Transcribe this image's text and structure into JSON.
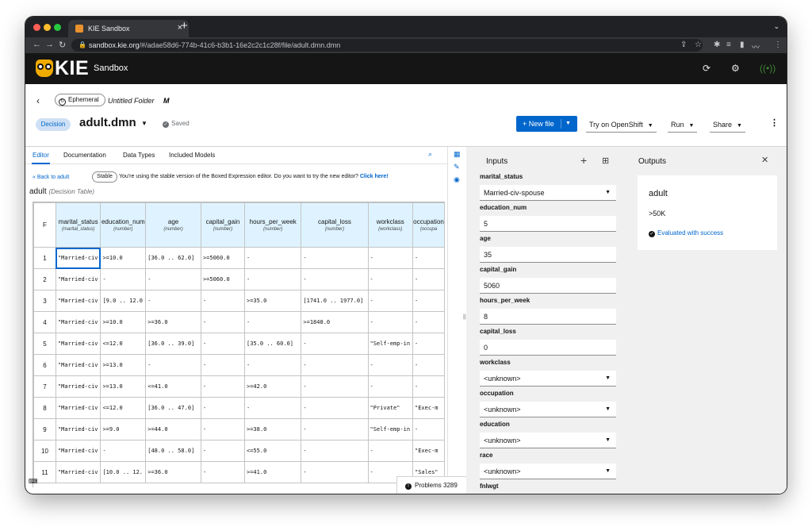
{
  "browser": {
    "tab_title": "KIE Sandbox",
    "tab_close": "×",
    "new_tab": "+",
    "url_host": "sandbox.kie.org",
    "url_path": "/#/adae58d6-774b-41c6-b3b1-16e2c2c1c28f/file/adult.dmn.dmn"
  },
  "app": {
    "logo_text": "KIE",
    "name": "Sandbox"
  },
  "header": {
    "ephemeral_label": "Ephemeral",
    "folder_name": "Untitled Folder",
    "folder_badge": "M",
    "type_badge": "Decision",
    "file_name": "adult.dmn",
    "saved_label": "Saved",
    "new_file_label": "New file",
    "openshift_label": "Try on OpenShift",
    "run_label": "Run",
    "share_label": "Share"
  },
  "editor": {
    "tabs": [
      "Editor",
      "Documentation",
      "Data Types",
      "Included Models"
    ],
    "back_link": "Back to adult",
    "stable_badge": "Stable",
    "notice_text": "You're using the stable version of the Boxed Expression editor. Do you want to try the new editor?",
    "notice_link": "Click here!",
    "table_name": "adult",
    "table_kind": "(Decision Table)",
    "hit_policy": "F",
    "columns": [
      {
        "name": "marital_status",
        "type": "(marital_status)"
      },
      {
        "name": "education_num",
        "type": "(number)"
      },
      {
        "name": "age",
        "type": "(number)"
      },
      {
        "name": "capital_gain",
        "type": "(number)"
      },
      {
        "name": "hours_per_week",
        "type": "(number)"
      },
      {
        "name": "capital_loss",
        "type": "(number)"
      },
      {
        "name": "workclass",
        "type": "(workclass)"
      },
      {
        "name": "occupation",
        "type": "(occupa"
      }
    ],
    "rows": [
      [
        "1",
        "\"Married-civ",
        ">=10.0",
        "[36.0 .. 62.0]",
        ">=5060.0",
        "-",
        "-",
        "-",
        "-"
      ],
      [
        "2",
        "\"Married-civ",
        "-",
        "-",
        ">=5060.0",
        "-",
        "-",
        "-",
        "-"
      ],
      [
        "3",
        "\"Married-civ",
        "[9.0 .. 12.0",
        "-",
        "-",
        ">=35.0",
        "[1741.0 .. 1977.0]",
        "-",
        "-"
      ],
      [
        "4",
        "\"Married-civ",
        ">=10.0",
        ">=36.0",
        "-",
        "-",
        ">=1848.0",
        "-",
        "-"
      ],
      [
        "5",
        "\"Married-civ",
        "<=12.0",
        "[36.0 .. 39.0]",
        "-",
        "[35.0 .. 60.0]",
        "-",
        "\"Self-emp-in",
        "-"
      ],
      [
        "6",
        "\"Married-civ",
        ">=13.0",
        "-",
        "-",
        "-",
        "-",
        "-",
        "-"
      ],
      [
        "7",
        "\"Married-civ",
        ">=13.0",
        "<=41.0",
        "-",
        ">=42.0",
        "-",
        "-",
        "-"
      ],
      [
        "8",
        "\"Married-civ",
        "<=12.0",
        "[36.0 .. 47.0]",
        "-",
        "-",
        "-",
        "\"Private\"",
        "\"Exec-m"
      ],
      [
        "9",
        "\"Married-civ",
        ">=9.0",
        ">=44.0",
        "-",
        ">=38.0",
        "-",
        "\"Self-emp-in",
        "-"
      ],
      [
        "10",
        "\"Married-civ",
        "-",
        "[48.0 .. 58.0]",
        "-",
        "<=55.0",
        "-",
        "-",
        "\"Exec-m"
      ],
      [
        "11",
        "\"Married-civ",
        "[10.0 .. 12.",
        ">=36.0",
        "-",
        ">=41.0",
        "-",
        "-",
        "\"Sales\""
      ]
    ],
    "problems_label": "Problems 3289"
  },
  "inputs": {
    "title": "Inputs",
    "fields": [
      {
        "label": "marital_status",
        "value": "Married-civ-spouse",
        "select": true
      },
      {
        "label": "education_num",
        "value": "5",
        "select": false
      },
      {
        "label": "age",
        "value": "35",
        "select": false
      },
      {
        "label": "capital_gain",
        "value": "5060",
        "select": false
      },
      {
        "label": "hours_per_week",
        "value": "8",
        "select": false
      },
      {
        "label": "capital_loss",
        "value": "0",
        "select": false
      },
      {
        "label": "workclass",
        "value": "<unknown>",
        "select": true
      },
      {
        "label": "occupation",
        "value": "<unknown>",
        "select": true
      },
      {
        "label": "education",
        "value": "<unknown>",
        "select": true
      },
      {
        "label": "race",
        "value": "<unknown>",
        "select": true
      },
      {
        "label": "fnlwgt",
        "value": "",
        "select": false
      }
    ]
  },
  "outputs": {
    "title": "Outputs",
    "result_name": "adult",
    "result_value": ">50K",
    "status_text": "Evaluated with success"
  },
  "colors": {
    "accent": "#0066cc",
    "appbar": "#151515",
    "header_cell": "#def3ff",
    "logo": "#f0ab00"
  }
}
